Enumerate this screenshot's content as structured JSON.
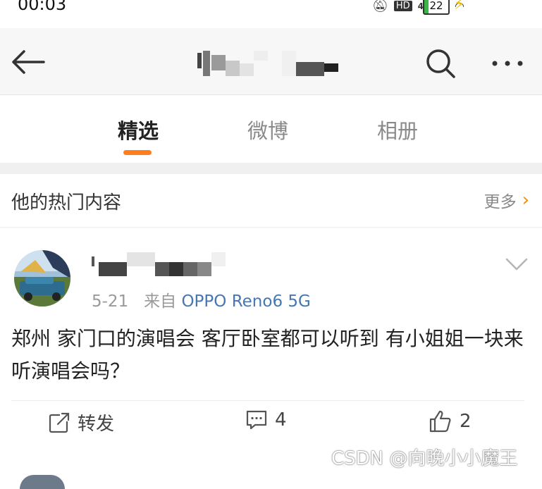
{
  "status_bar": {
    "time": "00:03",
    "battery_level": "22",
    "network": "4G",
    "hd_label": "HD"
  },
  "header": {
    "title": ""
  },
  "tabs": [
    {
      "label": "精选",
      "active": true
    },
    {
      "label": "微博",
      "active": false
    },
    {
      "label": "相册",
      "active": false
    }
  ],
  "section": {
    "title": "他的热门内容",
    "more_label": "更多"
  },
  "post": {
    "date": "5-21",
    "source_prefix": "来自",
    "device": "OPPO Reno6 5G",
    "text": "郑州  家门口的演唱会  客厅卧室都可以听到  有小姐姐一块来听演唱会吗？",
    "repost_label": "转发",
    "comment_count": "4",
    "like_count": "2"
  },
  "watermark": "CSDN @向晚小小魔王",
  "colors": {
    "accent": "#ff7f1f",
    "link": "#4677b3",
    "more_chevron": "#ff8a00"
  }
}
